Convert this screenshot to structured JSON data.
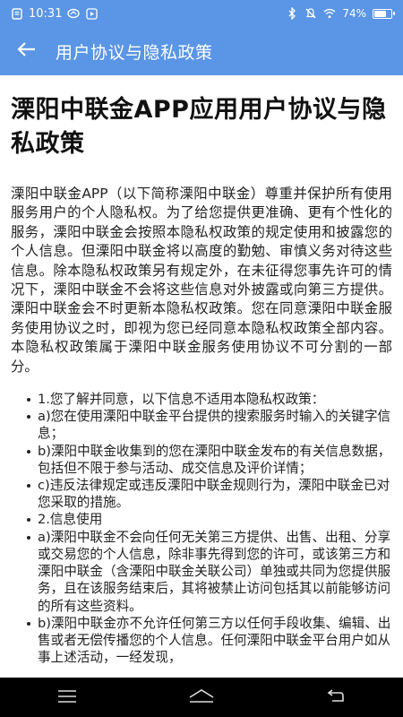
{
  "status_bar": {
    "time": "10:31",
    "battery_percent": "74%",
    "battery_level": 0.74,
    "icons": [
      "document-icon",
      "cloud-icon",
      "play-icon",
      "bluetooth-icon",
      "mute-icon",
      "wifi-icon",
      "battery-icon"
    ]
  },
  "app_bar": {
    "title": "用户协议与隐私政策",
    "background": "#5a95e6"
  },
  "document": {
    "title": "溧阳中联金APP应用用户协议与隐私政策",
    "intro": "溧阳中联金APP（以下简称溧阳中联金）尊重并保护所有使用服务用户的个人隐私权。为了给您提供更准确、更有个性化的服务，溧阳中联金会按照本隐私权政策的规定使用和披露您的个人信息。但溧阳中联金将以高度的勤勉、审慎义务对待这些信息。除本隐私权政策另有规定外，在未征得您事先许可的情况下，溧阳中联金不会将这些信息对外披露或向第三方提供。溧阳中联金会不时更新本隐私权政策。您在同意溧阳中联金服务使用协议之时，即视为您已经同意本隐私权政策全部内容。本隐私权政策属于溧阳中联金服务使用协议不可分割的一部分。",
    "items": [
      "1.您了解并同意，以下信息不适用本隐私权政策：",
      "a)您在使用溧阳中联金平台提供的搜索服务时输入的关键字信息；",
      "b)溧阳中联金收集到的您在溧阳中联金发布的有关信息数据，包括但不限于参与活动、成交信息及评价详情；",
      "c)违反法律规定或违反溧阳中联金规则行为，溧阳中联金已对您采取的措施。",
      "2.信息使用",
      "a)溧阳中联金不会向任何无关第三方提供、出售、出租、分享或交易您的个人信息，除非事先得到您的许可，或该第三方和溧阳中联金（含溧阳中联金关联公司）单独或共同为您提供服务，且在该服务结束后，其将被禁止访问包括其以前能够访问的所有这些资料。",
      "b)溧阳中联金亦不允许任何第三方以任何手段收集、编辑、出售或者无偿传播您的个人信息。任何溧阳中联金平台用户如从事上述活动，一经发现，"
    ]
  },
  "nav_bar": {
    "buttons": [
      "menu-icon",
      "home-icon",
      "back-icon"
    ]
  }
}
